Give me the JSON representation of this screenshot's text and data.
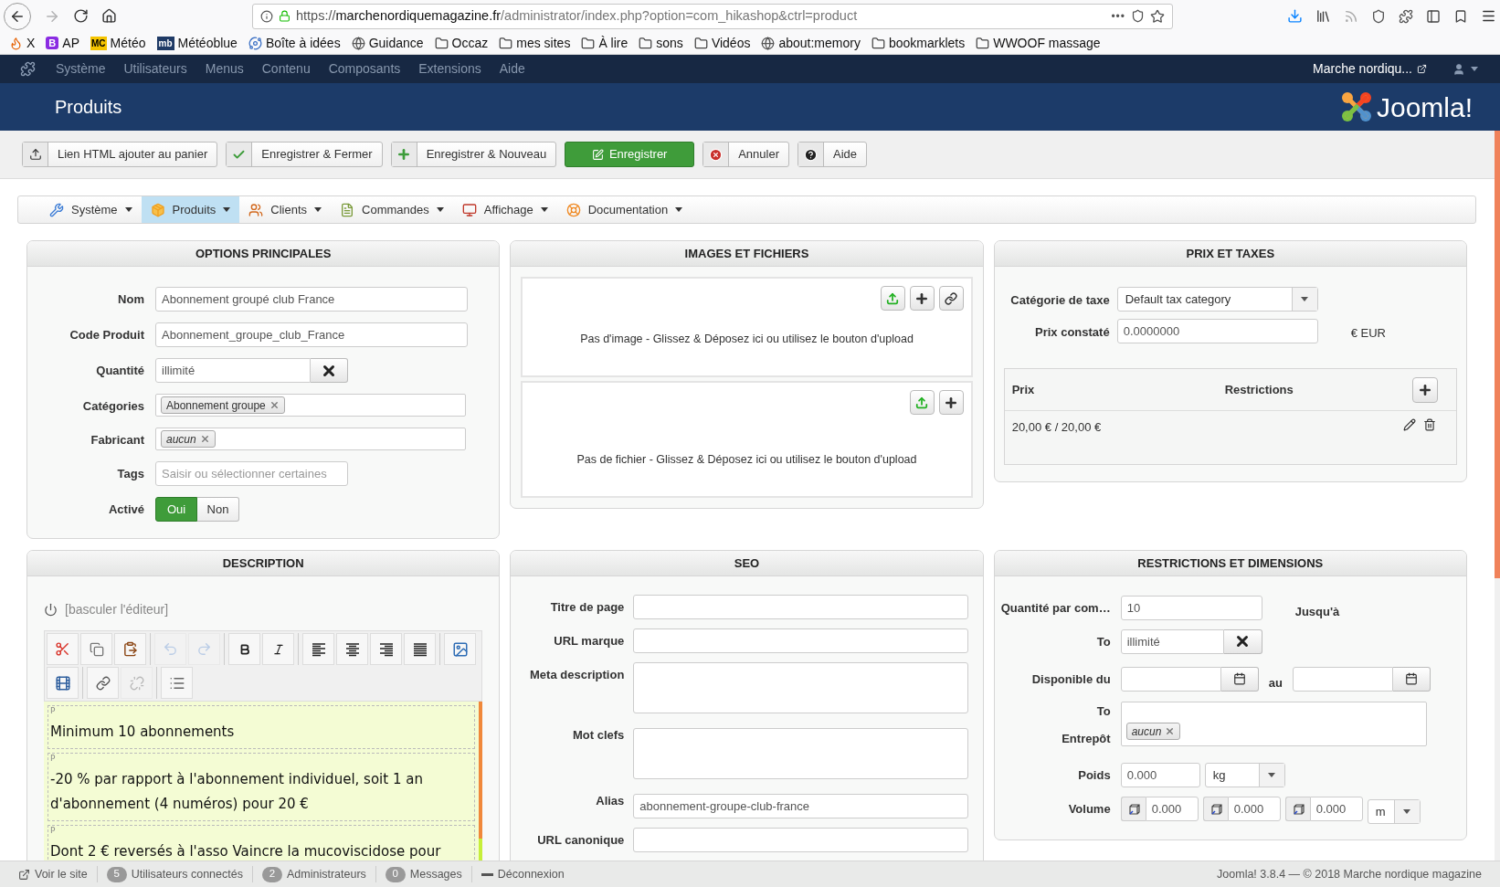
{
  "browser": {
    "nav": [
      {
        "kind": "back",
        "disabled": false
      },
      {
        "kind": "forward",
        "disabled": true
      },
      {
        "kind": "reload",
        "disabled": false
      },
      {
        "kind": "home",
        "disabled": false
      }
    ],
    "url": {
      "scheme": "https://",
      "host": "marchenordiquemagazine.fr",
      "path": "/administrator/index.php?option=com_hikashop&ctrl=product"
    },
    "menu_dots": "•••",
    "bookmarks": [
      {
        "kind": "firefox",
        "label": "X"
      },
      {
        "kind": "letter",
        "badge": "B",
        "color": "#8a2be2",
        "label": "AP"
      },
      {
        "kind": "badge",
        "badge": "MC",
        "color": "#f5c400",
        "label": "Météo"
      },
      {
        "kind": "badge_inverse",
        "badge": "mb",
        "color": "#1f3a66",
        "label": "Météoblue"
      },
      {
        "kind": "planet",
        "label": "Boîte à idées"
      },
      {
        "kind": "globe",
        "label": "Guidance"
      },
      {
        "kind": "folder",
        "label": "Occaz"
      },
      {
        "kind": "folder",
        "label": "mes sites"
      },
      {
        "kind": "folder",
        "label": "À lire"
      },
      {
        "kind": "folder",
        "label": "sons"
      },
      {
        "kind": "folder",
        "label": "Vidéos"
      },
      {
        "kind": "globe",
        "label": "about:memory"
      },
      {
        "kind": "folder",
        "label": "bookmarklets"
      },
      {
        "kind": "folder",
        "label": "WWOOF massage"
      }
    ]
  },
  "admin_menu": {
    "items": [
      "Système",
      "Utilisateurs",
      "Menus",
      "Contenu",
      "Composants",
      "Extensions",
      "Aide"
    ],
    "site_link": "Marche nordiqu..."
  },
  "header": {
    "title": "Produits",
    "logo_text": "Joomla!"
  },
  "toolbar": [
    {
      "kind": "default",
      "label": "Lien HTML ajouter au panier"
    },
    {
      "kind": "default",
      "label": "Enregistrer & Fermer"
    },
    {
      "kind": "default",
      "label": "Enregistrer & Nouveau"
    },
    {
      "kind": "primary",
      "label": "Enregistrer"
    },
    {
      "kind": "default",
      "label": "Annuler"
    },
    {
      "kind": "default",
      "label": "Aide"
    }
  ],
  "submenu": [
    {
      "label": "Système",
      "selected": false
    },
    {
      "label": "Produits",
      "selected": true
    },
    {
      "label": "Clients",
      "selected": false
    },
    {
      "label": "Commandes",
      "selected": false
    },
    {
      "label": "Affichage",
      "selected": false
    },
    {
      "label": "Documentation",
      "selected": false
    }
  ],
  "options": {
    "title": "OPTIONS PRINCIPALES",
    "fields": [
      {
        "kind": "text",
        "label": "Nom",
        "value": "Abonnement groupé club France"
      },
      {
        "kind": "text",
        "label": "Code Produit",
        "value": "Abonnement_groupe_club_France"
      },
      {
        "kind": "clearable",
        "label": "Quantité",
        "value": "illimité"
      },
      {
        "kind": "tags",
        "label": "Catégories",
        "tags": [
          {
            "text": "Abonnement groupe",
            "italic": false
          }
        ]
      },
      {
        "kind": "tags",
        "label": "Fabricant",
        "tags": [
          {
            "text": "aucun",
            "italic": true
          }
        ]
      },
      {
        "kind": "short",
        "label": "Tags",
        "placeholder": "Saisir ou sélectionner certaines"
      },
      {
        "kind": "toggle",
        "label": "Activé",
        "options": [
          {
            "label": "Oui",
            "selected": true
          },
          {
            "label": "Non",
            "selected": false
          }
        ]
      }
    ]
  },
  "images": {
    "title": "IMAGES ET FICHIERS",
    "sections": [
      {
        "message": "Pas d'image - Glissez & Déposez ici ou utilisez le bouton d'upload",
        "link_button": true
      },
      {
        "message": "Pas de fichier - Glissez & Déposez ici ou utilisez le bouton d'upload",
        "link_button": false
      }
    ]
  },
  "prices": {
    "title": "PRIX ET TAXES",
    "tax_label": "Catégorie de taxe",
    "tax_value": "Default tax category",
    "price_label": "Prix constaté",
    "price_value": "0.0000000",
    "currency": "€ EUR",
    "table": {
      "columns": [
        "Prix",
        "Restrictions"
      ],
      "rows": [
        {
          "cells": [
            "20,00 € / 20,00 €"
          ]
        }
      ]
    }
  },
  "description": {
    "title": "DESCRIPTION",
    "toggle": "[basculer l'éditeur]",
    "editor_toolbar": [
      [
        [
          {
            "kind": "cut",
            "disabled": false
          },
          {
            "kind": "copy",
            "disabled": false
          },
          {
            "kind": "paste",
            "disabled": false
          }
        ],
        [
          {
            "kind": "undo",
            "disabled": true
          },
          {
            "kind": "redo",
            "disabled": true
          }
        ],
        [
          {
            "kind": "bold",
            "disabled": false
          },
          {
            "kind": "italic",
            "disabled": false
          }
        ],
        [
          {
            "kind": "align_left",
            "disabled": false
          },
          {
            "kind": "align_center",
            "disabled": false
          },
          {
            "kind": "align_right",
            "disabled": false
          },
          {
            "kind": "justify",
            "disabled": false
          }
        ],
        [
          {
            "kind": "image",
            "disabled": false
          }
        ]
      ],
      [
        [
          {
            "kind": "media",
            "disabled": false
          }
        ],
        [
          {
            "kind": "link",
            "disabled": false
          },
          {
            "kind": "unlink",
            "disabled": true
          }
        ],
        [
          {
            "kind": "list",
            "disabled": false
          }
        ]
      ]
    ],
    "paragraphs": [
      {
        "tag": "P",
        "text": "Minimum 10 abonnements"
      },
      {
        "tag": "P",
        "text": "-20 % par rapport à l'abonnement individuel, soit 1 an d'abonnement (4 numéros) pour 20 €"
      },
      {
        "tag": "P",
        "text": "Dont 2 € reversés à l'asso Vaincre la mucoviscidose pour"
      }
    ]
  },
  "seo": {
    "title": "SEO",
    "fields": [
      {
        "kind": "text",
        "label": "Titre de page"
      },
      {
        "kind": "text",
        "label": "URL marque"
      },
      {
        "kind": "textarea",
        "label": "Meta description"
      },
      {
        "kind": "textarea",
        "label": "Mot clefs"
      },
      {
        "kind": "text",
        "label": "Alias",
        "value": "abonnement-groupe-club-france"
      },
      {
        "kind": "text",
        "label": "URL canonique"
      }
    ]
  },
  "restrictions": {
    "title": "RESTRICTIONS ET DIMENSIONS",
    "quantity": {
      "label": "Quantité par com…",
      "value": "10",
      "until_label": "Jusqu'à"
    },
    "to": {
      "label": "To",
      "value": "illimité"
    },
    "available": {
      "label": "Disponible du",
      "between": "au"
    },
    "warehouse": {
      "to_label": "To",
      "label": "Entrepôt",
      "tags": [
        {
          "text": "aucun",
          "italic": true
        }
      ]
    },
    "weight": {
      "label": "Poids",
      "value": "0.000",
      "unit": "kg"
    },
    "volume": {
      "label": "Volume",
      "values": [
        "0.000",
        "0.000",
        "0.000"
      ],
      "unit": "m"
    }
  },
  "status_bar": {
    "items": [
      {
        "kind": "link",
        "label": "Voir le site"
      },
      {
        "kind": "count",
        "count": "5",
        "label": "Utilisateurs connectés"
      },
      {
        "kind": "count",
        "count": "2",
        "label": "Administrateurs"
      },
      {
        "kind": "count",
        "count": "0",
        "label": "Messages"
      },
      {
        "kind": "logout",
        "label": "Déconnexion"
      }
    ],
    "copyright": "Joomla! 3.8.4 — © 2018 Marche nordique magazine"
  }
}
